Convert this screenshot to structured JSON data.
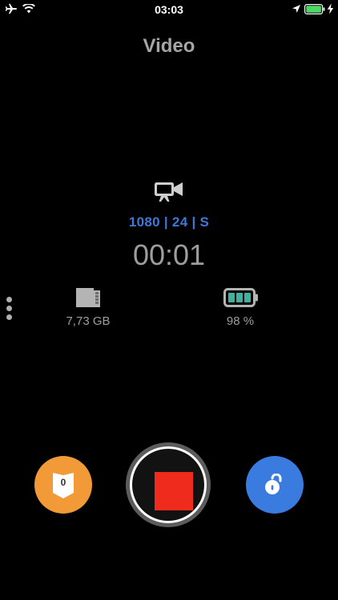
{
  "status_bar": {
    "time": "03:03",
    "icons": [
      "airplane-icon",
      "wifi-icon",
      "location-icon",
      "battery-icon",
      "charging-bolt-icon"
    ]
  },
  "screen": {
    "title": "Video"
  },
  "recording": {
    "camera_icon": "video-camera-icon",
    "format": "1080 | 24 | S",
    "elapsed": "00:01"
  },
  "storage": {
    "icon": "sd-card-icon",
    "free": "7,73 GB"
  },
  "battery": {
    "icon": "battery-icon",
    "level_text": "98 %",
    "level": 0.98
  },
  "controls": {
    "left_button": {
      "icon": "shield-icon",
      "count": "0",
      "color": "#f29a38"
    },
    "record_button": {
      "icon": "stop-icon",
      "color": "#ee2b1d"
    },
    "right_button": {
      "icon": "unlock-icon",
      "color": "#3a7be0"
    }
  },
  "colors": {
    "background": "#000000",
    "accent_blue": "#3d78d8",
    "status_green": "#4cd964",
    "text_gray": "#9d9d9d"
  }
}
